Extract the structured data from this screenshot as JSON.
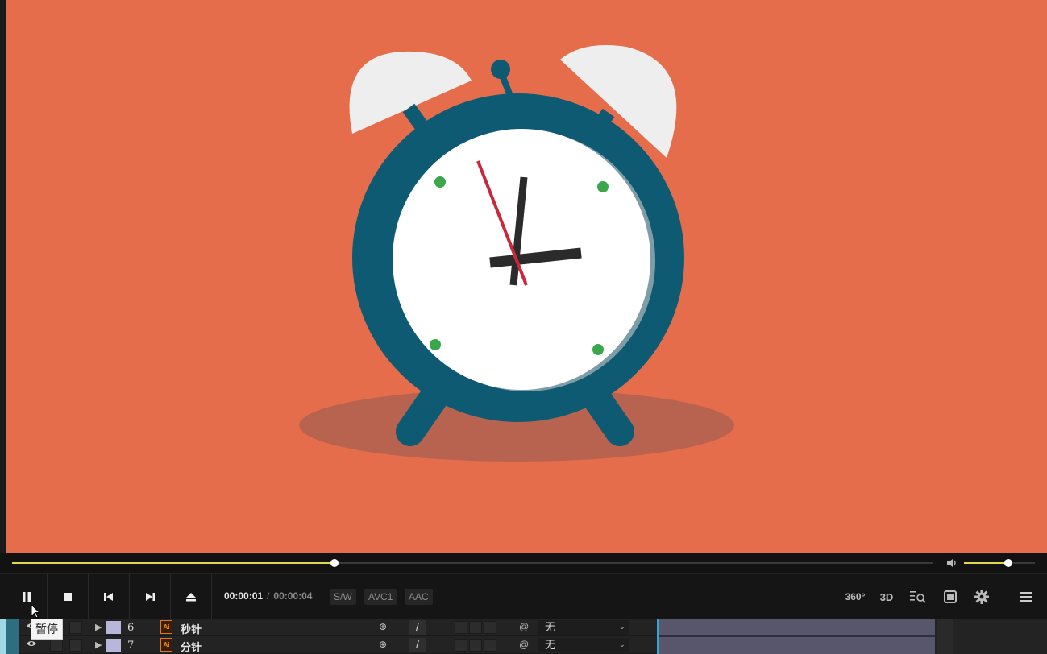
{
  "player": {
    "time_current": "00:00:01",
    "time_separator": "/",
    "time_total": "00:00:04",
    "tags": [
      "S/W",
      "AVC1",
      "AAC"
    ],
    "seek_progress": 0.35,
    "volume_level": 0.63,
    "tooltip": "暂停",
    "right_icons": [
      "360°",
      "3D"
    ]
  },
  "controls": [
    "pause-icon",
    "stop-icon",
    "previous-icon",
    "next-icon",
    "eject-icon",
    "vr-360-icon",
    "3d-icon",
    "zoom-list-icon",
    "window-icon",
    "settings-icon",
    "menu-icon"
  ],
  "layers": [
    {
      "number": "6",
      "name": "秒针",
      "mode": "无"
    },
    {
      "number": "7",
      "name": "分针",
      "mode": "无"
    }
  ],
  "colors": {
    "background": "#e66d4b",
    "clock_body": "#0f5a73",
    "accent": "#e3d84a",
    "second_hand": "#c9283c",
    "dot": "#3aa84a"
  }
}
